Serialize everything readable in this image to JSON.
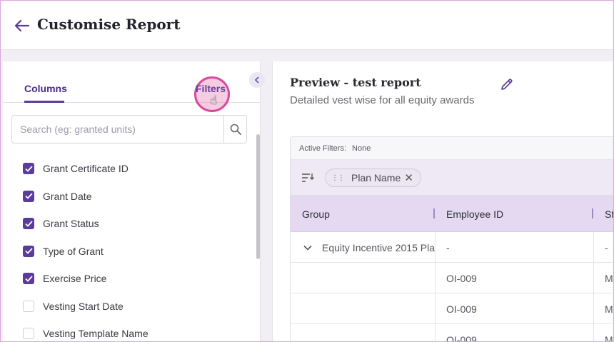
{
  "header": {
    "title": "Customise Report",
    "back_icon": "arrow-left-icon"
  },
  "left_panel": {
    "tabs": [
      {
        "label": "Columns",
        "active": true
      },
      {
        "label": "Filters",
        "active": false
      }
    ],
    "search": {
      "placeholder": "Search (eg: granted units)",
      "value": ""
    },
    "columns": [
      {
        "label": "Grant Certificate ID",
        "checked": true
      },
      {
        "label": "Grant Date",
        "checked": true
      },
      {
        "label": "Grant Status",
        "checked": true
      },
      {
        "label": "Type of Grant",
        "checked": true
      },
      {
        "label": "Exercise Price",
        "checked": true
      },
      {
        "label": "Vesting Start Date",
        "checked": false
      },
      {
        "label": "Vesting Template Name",
        "checked": false
      }
    ]
  },
  "preview": {
    "title": "Preview - test report",
    "subtitle": "Detailed vest wise for all equity awards",
    "active_filters_label": "Active Filters:",
    "active_filters_value": "None",
    "group_chip": "Plan Name",
    "headers": [
      "Group",
      "Employee ID",
      "St"
    ],
    "rows": [
      {
        "group": "Equity Incentive 2015 Pla",
        "employee_id": "-",
        "status": "-"
      },
      {
        "group": "",
        "employee_id": "OI-009",
        "status": "M"
      },
      {
        "group": "",
        "employee_id": "OI-009",
        "status": "M"
      },
      {
        "group": "",
        "employee_id": "OI-009",
        "status": "M"
      }
    ]
  },
  "colors": {
    "accent": "#5b3b9c",
    "header_row": "#e4d9f1",
    "click_highlight": "#d94a98"
  }
}
